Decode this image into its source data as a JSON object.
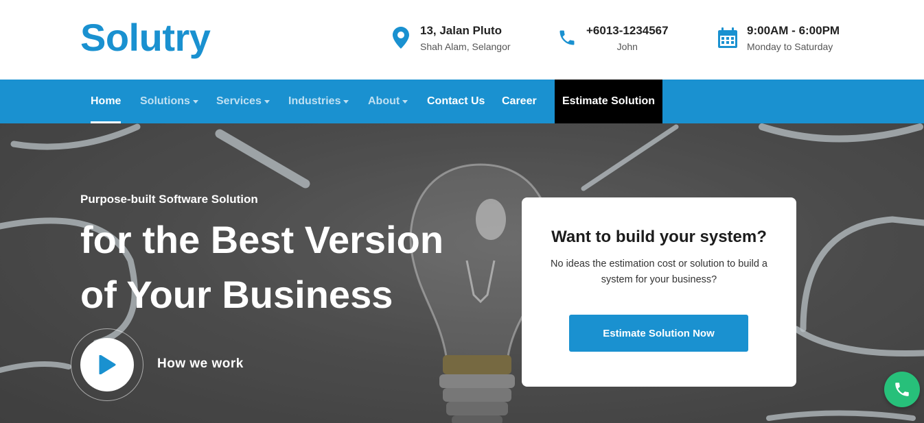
{
  "header": {
    "logo": "Solutry",
    "address": {
      "line1": "13, Jalan Pluto",
      "line2": "Shah Alam, Selangor",
      "icon": "map-pin-icon"
    },
    "phone": {
      "line1": "+6013-1234567",
      "line2": "John",
      "icon": "phone-icon"
    },
    "hours": {
      "line1": "9:00AM - 6:00PM",
      "line2": "Monday to Saturday",
      "icon": "calendar-icon"
    }
  },
  "nav": {
    "items": [
      {
        "label": "Home",
        "active": true
      },
      {
        "label": "Solutions",
        "dropdown": true
      },
      {
        "label": "Services",
        "dropdown": true
      },
      {
        "label": "Industries",
        "dropdown": true
      },
      {
        "label": "About",
        "dropdown": true
      },
      {
        "label": "Contact Us"
      },
      {
        "label": "Career"
      }
    ],
    "cta": "Estimate Solution"
  },
  "hero": {
    "subtitle": "Purpose-built Software Solution",
    "title_line1": "for the Best Version",
    "title_line2": "of Your Business",
    "video_link": "How we work",
    "play_icon": "play-icon"
  },
  "card": {
    "title": "Want to build your system?",
    "text": "No ideas the estimation cost or solution to build a system for your business?",
    "button": "Estimate Solution Now"
  },
  "floating": {
    "icon": "whatsapp-phone-icon"
  },
  "colors": {
    "brand": "#1a91d0",
    "cta_dark": "#000000",
    "whatsapp": "#27c07a"
  }
}
